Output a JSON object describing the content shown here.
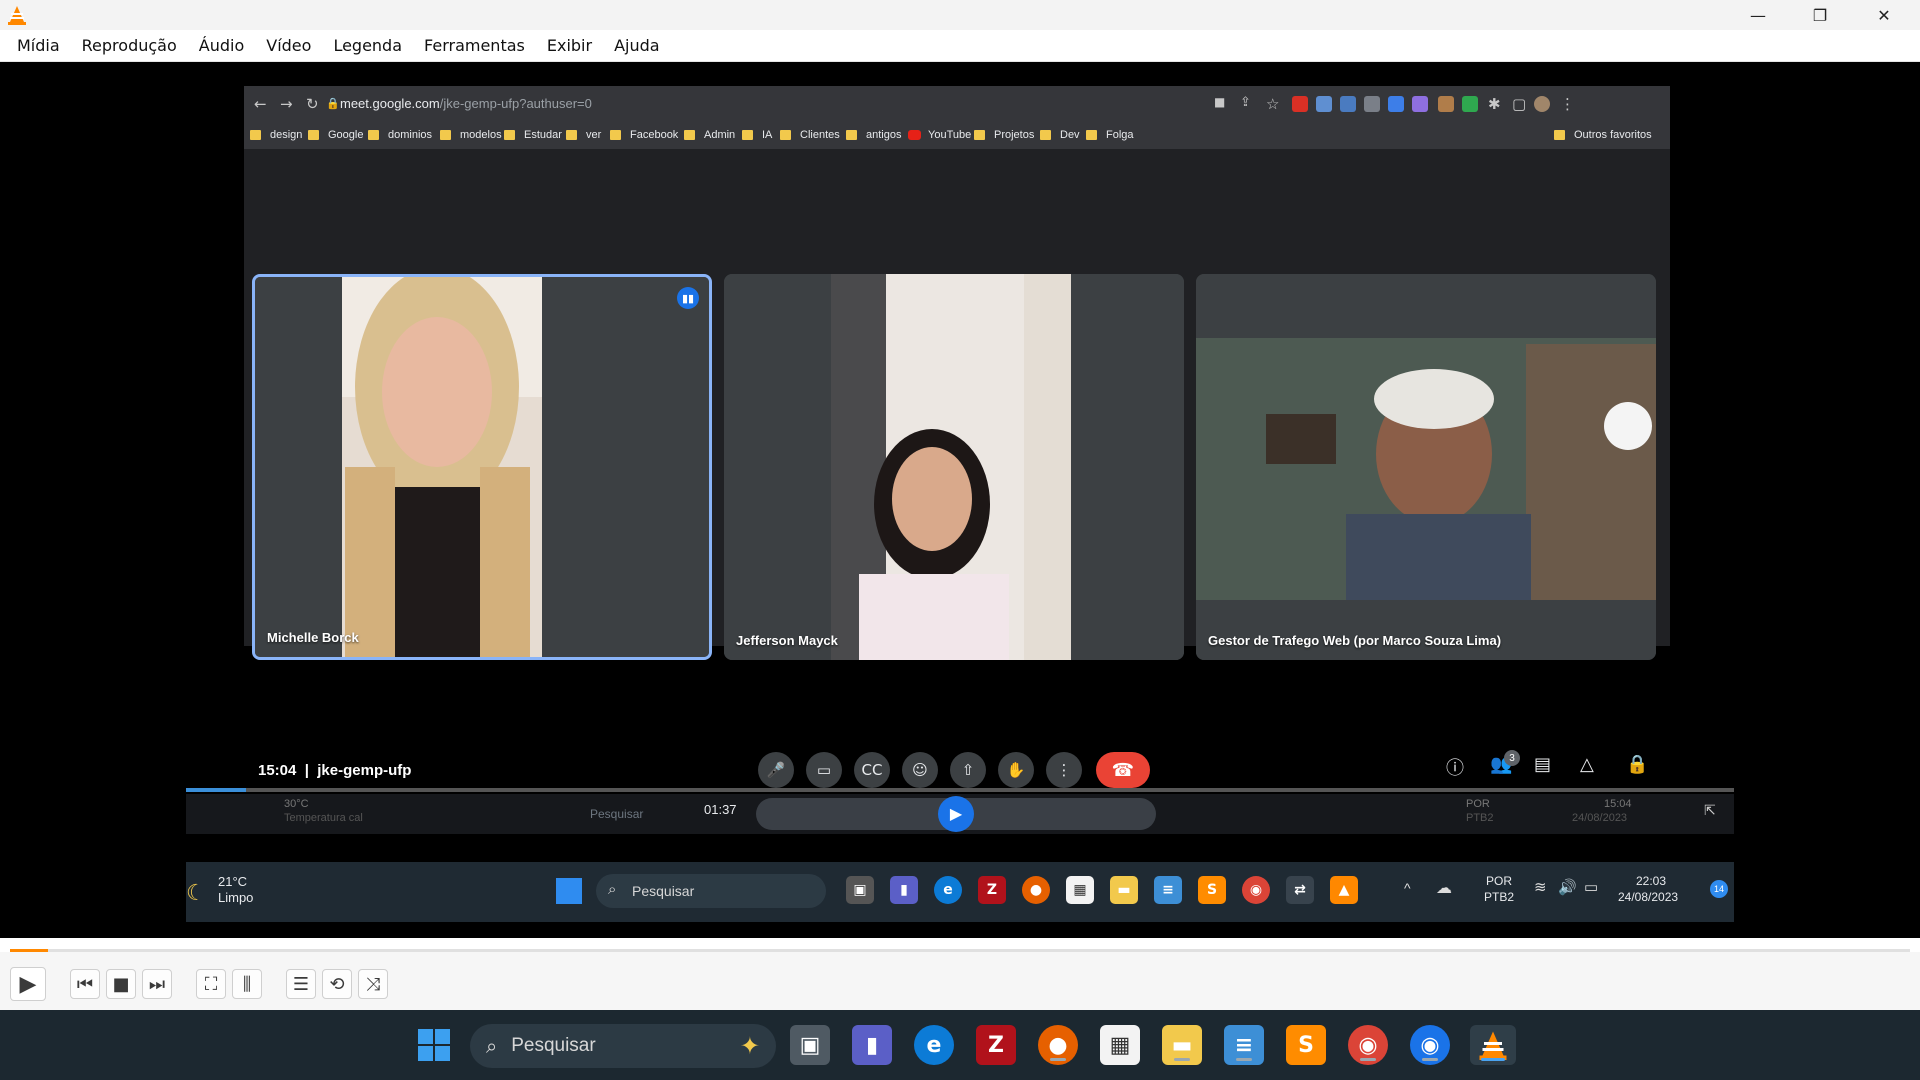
{
  "vlc": {
    "menu": [
      "Mídia",
      "Reprodução",
      "Áudio",
      "Vídeo",
      "Legenda",
      "Ferramentas",
      "Exibir",
      "Ajuda"
    ],
    "window_controls": [
      "—",
      "❐",
      "✕"
    ],
    "playback_progress": 0.02
  },
  "browser": {
    "url_host": "meet.google.com",
    "url_path": "/jke-gemp-ufp?authuser=0",
    "bookmarks": [
      "design",
      "Google",
      "dominios",
      "modelos",
      "Estudar",
      "ver",
      "Facebook",
      "Admin",
      "IA",
      "Clientes",
      "antigos",
      "YouTube",
      "Projetos",
      "Dev",
      "Folga"
    ],
    "other_bookmarks": "Outros favoritos"
  },
  "meet": {
    "participants": [
      "Michelle Borck",
      "Jefferson Mayck",
      "Gestor de Trafego Web (por Marco Souza Lima)"
    ],
    "time": "15:04",
    "meeting_code": "jke-gemp-ufp",
    "separator": "|",
    "participant_count": "3"
  },
  "recorded_taskbar": {
    "weather_temp": "30°C",
    "weather_desc": "Temperatura cal",
    "search": "Pesquisar",
    "player_time": "01:37",
    "lang": "POR",
    "lang_sub": "PTB2",
    "clock_time": "15:04",
    "clock_date": "24/08/2023",
    "weather2_temp": "21°C",
    "weather2_desc": "Limpo",
    "search2": "Pesquisar",
    "lang2": "POR",
    "lang2_sub": "PTB2",
    "clock2_time": "22:03",
    "clock2_date": "24/08/2023",
    "notification_count": "14"
  },
  "taskbar": {
    "search_placeholder": "Pesquisar"
  },
  "colors": {
    "accent": "#1a73e8",
    "end_call": "#ea4335",
    "vlc_orange": "#ff8800"
  }
}
